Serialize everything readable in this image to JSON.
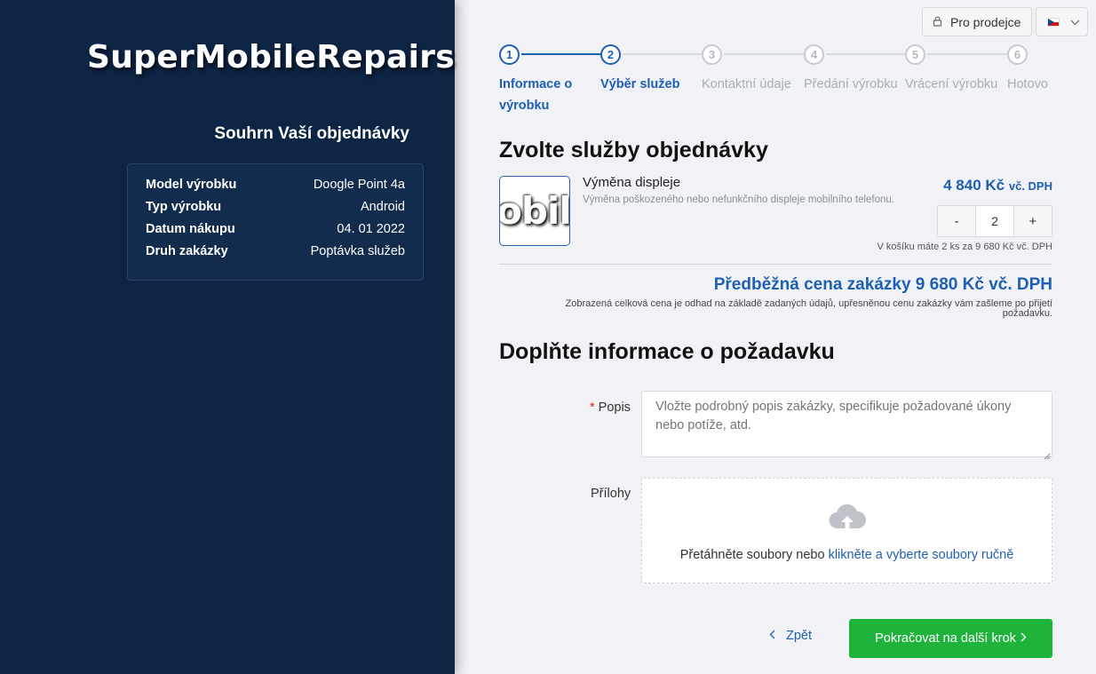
{
  "brand": {
    "logo_text": "SuperMobileRepairs"
  },
  "summary": {
    "title": "Souhrn Vaší objednávky",
    "rows": [
      {
        "label": "Model výrobku",
        "value": "Doogle Point 4a"
      },
      {
        "label": "Typ výrobku",
        "value": "Android"
      },
      {
        "label": "Datum nákupu",
        "value": "04. 01 2022"
      },
      {
        "label": "Druh zakázky",
        "value": "Poptávka služeb"
      }
    ]
  },
  "header": {
    "seller_label": "Pro prodejce",
    "language": "cs"
  },
  "steps": [
    {
      "number": "1",
      "label": "Informace o výrobku",
      "state": "done"
    },
    {
      "number": "2",
      "label": "Výběr služeb",
      "state": "current"
    },
    {
      "number": "3",
      "label": "Kontaktní údaje",
      "state": "pending"
    },
    {
      "number": "4",
      "label": "Předání výrobku",
      "state": "pending"
    },
    {
      "number": "5",
      "label": "Vrácení výrobku",
      "state": "pending"
    },
    {
      "number": "6",
      "label": "Hotovo",
      "state": "pending"
    }
  ],
  "services": {
    "heading": "Zvolte služby objednávky",
    "item": {
      "image_text": "obile",
      "name": "Výměna displeje",
      "description": "Výměna poškozeného nebo nefunkčního displeje mobilního telefonu.",
      "price": "4 840 Kč",
      "price_suffix": "vč. DPH",
      "qty_minus": "-",
      "qty_value": "2",
      "qty_plus": "+",
      "cart_note": "V košíku máte 2 ks za 9 680 Kč vč. DPH"
    },
    "total": "Předběžná cena zakázky 9 680 Kč vč. DPH",
    "total_note": "Zobrazená celková cena je odhad na základě zadaných údajů, upřesněnou cenu zakázky vám zašleme po přijetí požadavku."
  },
  "form": {
    "heading": "Doplňte informace o požadavku",
    "required_mark": "*",
    "description_label": "Popis",
    "description_placeholder": "Vložte podrobný popis zakázky, specifikuje požadované úkony nebo potíže, atd.",
    "attachments_label": "Přílohy",
    "drop_text": "Přetáhněte soubory nebo ",
    "drop_link": "klikněte a vyberte soubory ručně"
  },
  "actions": {
    "back_label": "Zpět",
    "next_label": "Pokračovat na další krok"
  },
  "colors": {
    "sidebar": "#0c2545",
    "accent": "#1f5fb3",
    "primary_button": "#1fb33c"
  }
}
